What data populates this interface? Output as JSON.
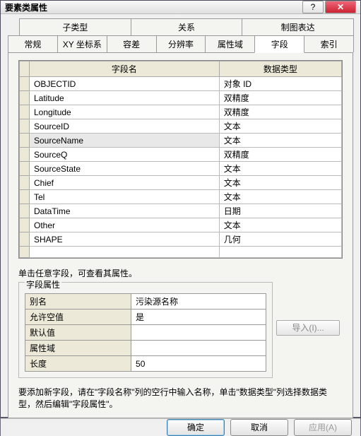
{
  "window": {
    "title": "要素类属性",
    "help": "?",
    "close": "✕"
  },
  "tabs_row1": [
    "子类型",
    "关系",
    "制图表达"
  ],
  "tabs_row2": [
    "常规",
    "XY 坐标系",
    "容差",
    "分辨率",
    "属性域",
    "字段",
    "索引"
  ],
  "active_tab": "字段",
  "grid": {
    "headers": [
      "字段名",
      "数据类型"
    ],
    "rows": [
      {
        "name": "OBJECTID",
        "type": "对象 ID"
      },
      {
        "name": "Latitude",
        "type": "双精度"
      },
      {
        "name": "Longitude",
        "type": "双精度"
      },
      {
        "name": "SourceID",
        "type": "文本"
      },
      {
        "name": "SourceName",
        "type": "文本",
        "selected": true
      },
      {
        "name": "SourceQ",
        "type": "双精度"
      },
      {
        "name": "SourceState",
        "type": "文本"
      },
      {
        "name": "Chief",
        "type": "文本"
      },
      {
        "name": "Tel",
        "type": "文本"
      },
      {
        "name": "DataTime",
        "type": "日期"
      },
      {
        "name": "Other",
        "type": "文本"
      },
      {
        "name": "SHAPE",
        "type": "几何"
      },
      {
        "name": "",
        "type": ""
      }
    ]
  },
  "note": "单击任意字段，可查看其属性。",
  "fieldset_title": "字段属性",
  "props": [
    {
      "k": "别名",
      "v": "污染源名称"
    },
    {
      "k": "允许空值",
      "v": "是"
    },
    {
      "k": "默认值",
      "v": ""
    },
    {
      "k": "属性域",
      "v": ""
    },
    {
      "k": "长度",
      "v": "50"
    }
  ],
  "import_btn": "导入(I)...",
  "hint": "要添加新字段，请在\"字段名称\"列的空行中输入名称，单击\"数据类型\"列选择数据类型，然后编辑\"字段属性\"。",
  "buttons": {
    "ok": "确定",
    "cancel": "取消",
    "apply": "应用(A)"
  }
}
